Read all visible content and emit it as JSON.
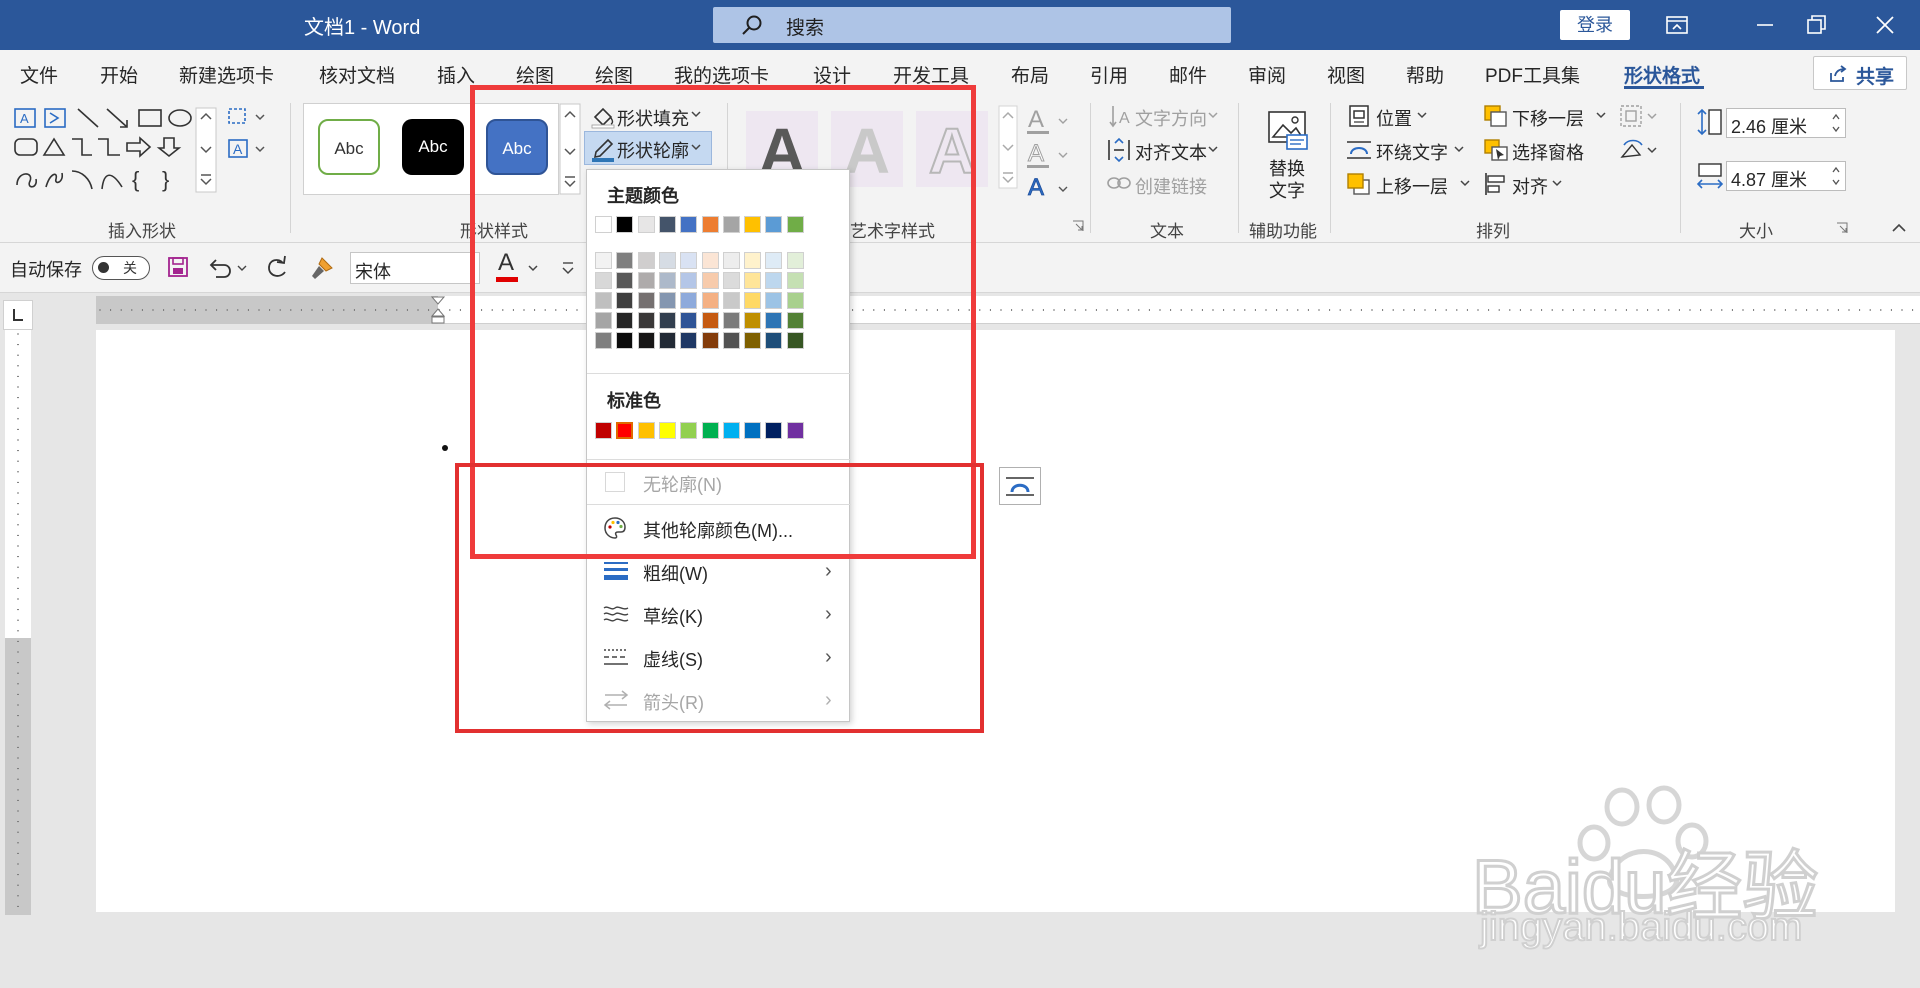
{
  "title_bar": {
    "doc_title": "文档1  -  Word",
    "search_placeholder": "搜索",
    "login_label": "登录"
  },
  "tabs": [
    "文件",
    "开始",
    "新建选项卡",
    "核对文档",
    "插入",
    "绘图",
    "绘图",
    "我的选项卡",
    "设计",
    "开发工具",
    "布局",
    "引用",
    "邮件",
    "审阅",
    "视图",
    "帮助",
    "PDF工具集",
    "形状格式"
  ],
  "active_tab": "形状格式",
  "share_label": "共享",
  "ribbon": {
    "groups": {
      "insert_shapes": "插入形状",
      "shape_styles": "形状样式",
      "wordart_styles": "艺术字样式",
      "text": "文本",
      "accessibility": "辅助功能",
      "arrange": "排列",
      "size": "大小"
    },
    "shape_fill": "形状填充",
    "shape_outline": "形状轮廓",
    "style_sample": "Abc",
    "wordart_sample": "A",
    "text_direction": "文字方向",
    "align_text": "对齐文本",
    "create_link": "创建链接",
    "alt_text_line1": "替换",
    "alt_text_line2": "文字",
    "position": "位置",
    "wrap_text": "环绕文字",
    "bring_forward": "上移一层",
    "send_backward": "下移一层",
    "selection_pane": "选择窗格",
    "align": "对齐",
    "height": "2.46 厘米",
    "width": "4.87 厘米"
  },
  "qat": {
    "autosave_label": "自动保存",
    "autosave_state": "关",
    "font_name": "宋体",
    "font_color_letter": "A",
    "font_color": "#e00000"
  },
  "outline_menu": {
    "theme_colors_title": "主题颜色",
    "standard_colors_title": "标准色",
    "theme_colors": [
      "#ffffff",
      "#000000",
      "#e7e6e6",
      "#44546a",
      "#4472c4",
      "#ed7d31",
      "#a5a5a5",
      "#ffc000",
      "#5b9bd5",
      "#70ad47"
    ],
    "theme_shades": [
      [
        "#f2f2f2",
        "#7f7f7f",
        "#d0cece",
        "#d6dce4",
        "#d9e2f3",
        "#fbe5d5",
        "#ededed",
        "#fff2cc",
        "#deebf6",
        "#e2efd9"
      ],
      [
        "#d8d8d8",
        "#595959",
        "#aeabab",
        "#adb9ca",
        "#b4c6e7",
        "#f7cbac",
        "#dbdbdb",
        "#ffe599",
        "#bdd7ee",
        "#c5e0b3"
      ],
      [
        "#bfbfbf",
        "#3f3f3f",
        "#757070",
        "#8496b0",
        "#8eaadb",
        "#f4b083",
        "#c9c9c9",
        "#ffd965",
        "#9cc3e5",
        "#a8d08d"
      ],
      [
        "#a5a5a5",
        "#262626",
        "#3a3838",
        "#323f4f",
        "#2f5496",
        "#c55a11",
        "#7b7b7b",
        "#bf8f00",
        "#2e75b5",
        "#538135"
      ],
      [
        "#7f7f7f",
        "#0c0c0c",
        "#171616",
        "#222a35",
        "#1f3864",
        "#833c0b",
        "#525252",
        "#7f6000",
        "#1e4e79",
        "#375623"
      ]
    ],
    "standard_colors": [
      "#c00000",
      "#ff0000",
      "#ffc000",
      "#ffff00",
      "#92d050",
      "#00b050",
      "#00b0f0",
      "#0070c0",
      "#002060",
      "#7030a0"
    ],
    "no_outline": "无轮廓(N)",
    "more_colors": "其他轮廓颜色(M)...",
    "weight": "粗细(W)",
    "sketched": "草绘(K)",
    "dashes": "虚线(S)",
    "arrows": "箭头(R)"
  },
  "watermark": {
    "brand": "Baidu经验",
    "url": "jingyan.baidu.com"
  }
}
